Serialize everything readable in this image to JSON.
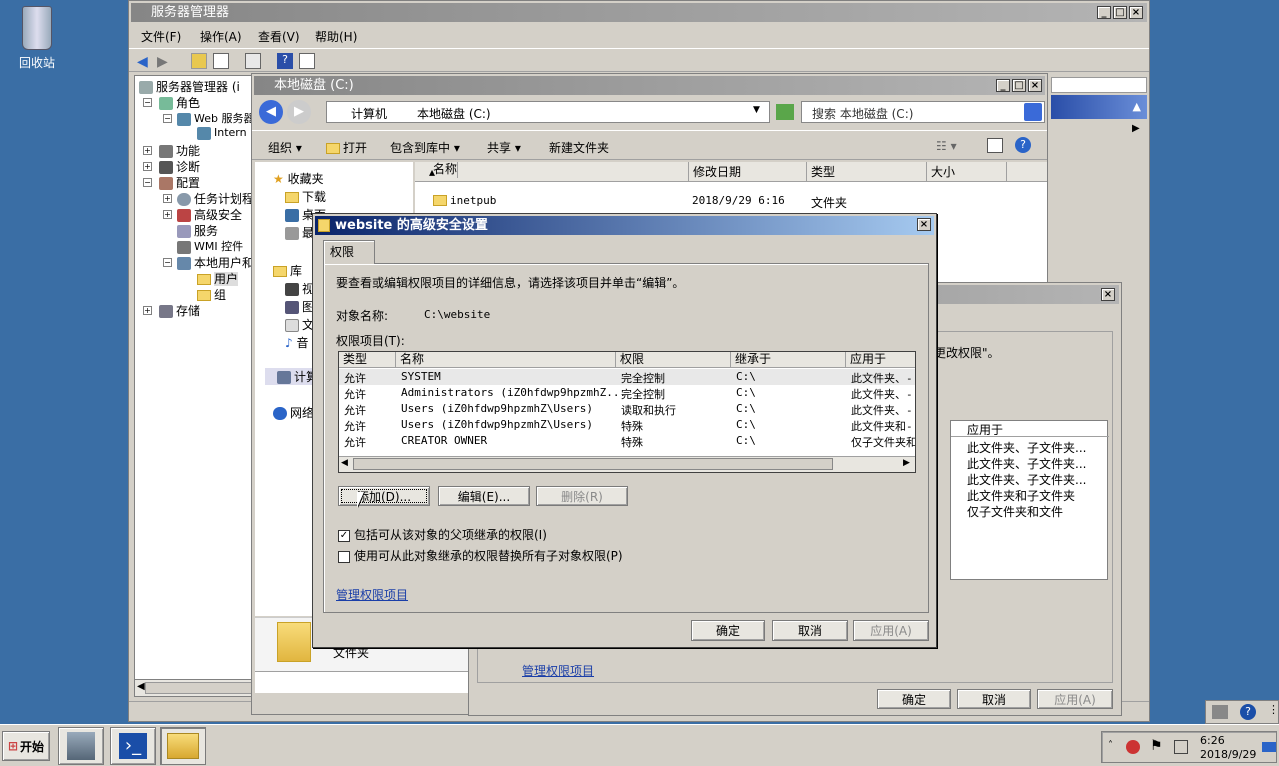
{
  "desktop": {
    "recycle_bin": "回收站"
  },
  "server_manager": {
    "title": "服务器管理器",
    "menu": [
      "文件(F)",
      "操作(A)",
      "查看(V)",
      "帮助(H)"
    ],
    "tree": [
      "服务器管理器 (i",
      "角色",
      "Web 服务器",
      "Intern",
      "功能",
      "诊断",
      "配置",
      "任务计划程",
      "高级安全",
      "服务",
      "WMI 控件",
      "本地用户和",
      "用户",
      "组",
      "存储"
    ]
  },
  "explorer": {
    "title": "本地磁盘 (C:)",
    "breadcrumb": [
      "计算机",
      "本地磁盘 (C:)"
    ],
    "search_placeholder": "搜索 本地磁盘 (C:)",
    "toolbar": [
      "组织",
      "打开",
      "包含到库中",
      "共享",
      "新建文件夹"
    ],
    "columns": [
      "名称",
      "修改日期",
      "类型",
      "大小"
    ],
    "files": [
      {
        "name": "inetpub",
        "date": "2018/9/29 6:16",
        "type": "文件夹"
      }
    ],
    "nav": [
      "收藏夹",
      "下载",
      "桌面",
      "最近",
      "库",
      "视",
      "图",
      "文",
      "音",
      "计算机",
      "网络"
    ],
    "details_label": "文件夹"
  },
  "back_dialog": {
    "text_right": "更改权限\"。",
    "apply_col": "应用于",
    "apply_items": [
      "此文件夹、子文件夹...",
      "此文件夹、子文件夹...",
      "此文件夹、子文件夹...",
      "此文件夹和子文件夹",
      "仅子文件夹和文件"
    ],
    "manage_link": "管理权限项目",
    "ok": "确定",
    "cancel": "取消",
    "apply": "应用(A)"
  },
  "adv_dialog": {
    "title": "website 的高级安全设置",
    "tab": "权限",
    "intro": "要查看或编辑权限项目的详细信息，请选择该项目并单击“编辑”。",
    "object_label": "对象名称:",
    "object_value": "C:\\website",
    "entries_label": "权限项目(T):",
    "columns": [
      "类型",
      "名称",
      "权限",
      "继承于",
      "应用于"
    ],
    "rows": [
      [
        "允许",
        "SYSTEM",
        "完全控制",
        "C:\\",
        "此文件夹、-"
      ],
      [
        "允许",
        "Administrators (iZ0hfdwp9hpzmhZ...",
        "完全控制",
        "C:\\",
        "此文件夹、-"
      ],
      [
        "允许",
        "Users (iZ0hfdwp9hpzmhZ\\Users)",
        "读取和执行",
        "C:\\",
        "此文件夹、-"
      ],
      [
        "允许",
        "Users (iZ0hfdwp9hpzmhZ\\Users)",
        "特殊",
        "C:\\",
        "此文件夹和-"
      ],
      [
        "允许",
        "CREATOR OWNER",
        "特殊",
        "C:\\",
        "仅子文件夹和"
      ]
    ],
    "add": "添加(D)...",
    "edit": "编辑(E)...",
    "remove": "删除(R)",
    "cb1": "包括可从该对象的父项继承的权限(I)",
    "cb1_checked": true,
    "cb2": "使用可从此对象继承的权限替换所有子对象权限(P)",
    "cb2_checked": false,
    "manage_link": "管理权限项目",
    "ok": "确定",
    "cancel": "取消",
    "apply": "应用(A)"
  },
  "taskbar": {
    "start": "开始",
    "time": "6:26",
    "date": "2018/9/29"
  }
}
